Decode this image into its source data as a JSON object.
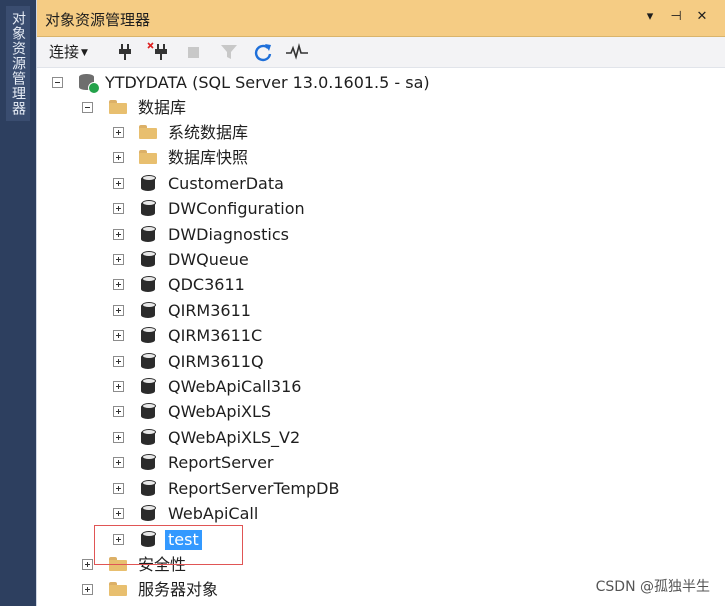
{
  "sidebar_tab": {
    "label": "对象资源管理器"
  },
  "panel": {
    "title": "对象资源管理器",
    "buttons": {
      "dropdown": "▾",
      "pin": "⊣",
      "close": "✕"
    }
  },
  "toolbar": {
    "connect_label": "连接",
    "icons": [
      "connect-plug-icon",
      "disconnect-plug-icon",
      "stop-icon",
      "filter-icon",
      "refresh-icon",
      "activity-monitor-icon"
    ]
  },
  "tree": {
    "server": {
      "label": "YTDYDATA (SQL Server 13.0.1601.5 - sa)",
      "expanded": true
    },
    "databases_folder": {
      "label": "数据库",
      "expanded": true
    },
    "system_folders": [
      {
        "label": "系统数据库"
      },
      {
        "label": "数据库快照"
      }
    ],
    "databases": [
      {
        "label": "CustomerData"
      },
      {
        "label": "DWConfiguration"
      },
      {
        "label": "DWDiagnostics"
      },
      {
        "label": "DWQueue"
      },
      {
        "label": "QDC3611"
      },
      {
        "label": "QIRM3611"
      },
      {
        "label": "QIRM3611C"
      },
      {
        "label": "QIRM3611Q"
      },
      {
        "label": "QWebApiCall316"
      },
      {
        "label": "QWebApiXLS"
      },
      {
        "label": "QWebApiXLS_V2"
      },
      {
        "label": "ReportServer"
      },
      {
        "label": "ReportServerTempDB"
      },
      {
        "label": "WebApiCall"
      },
      {
        "label": "test",
        "selected": true
      }
    ],
    "bottom_folders": [
      {
        "label": "安全性"
      },
      {
        "label": "服务器对象"
      }
    ]
  },
  "watermark": "CSDN @孤独半生",
  "colors": {
    "title_bar": "#f5cc84",
    "selection": "#3399ff",
    "highlight_border": "#e05555",
    "side_tab": "#2d3f5f"
  }
}
